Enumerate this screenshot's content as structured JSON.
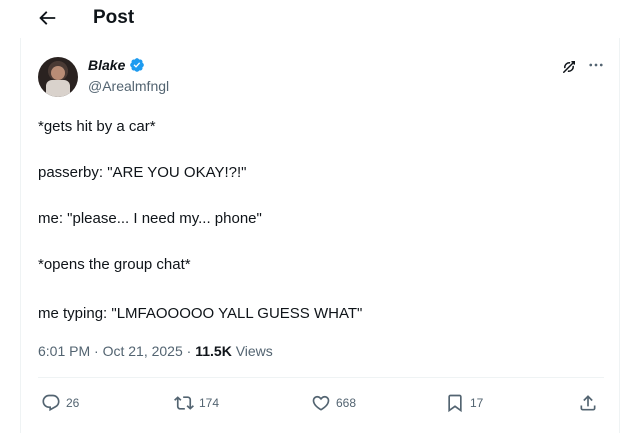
{
  "header": {
    "title": "Post"
  },
  "author": {
    "display_name": "Blake",
    "handle": "@Arealmfngl",
    "verified_color": "#1d9bf0"
  },
  "post": {
    "lines": [
      "*gets hit by a car*",
      "passerby: \"ARE YOU OKAY!?!\"",
      "me: \"please... I need my... phone\"",
      "*opens the group chat*",
      "me typing: \"LMFAOOOOO YALL GUESS WHAT\""
    ],
    "time": "6:01 PM",
    "separator": "·",
    "date": "Oct 21, 2025",
    "views_count": "11.5K",
    "views_label": "Views"
  },
  "actions": {
    "replies": "26",
    "reposts": "174",
    "likes": "668",
    "bookmarks": "17"
  },
  "icons": [
    "back-arrow-icon",
    "verified-badge-icon",
    "grok-icon",
    "more-icon",
    "reply-icon",
    "repost-icon",
    "like-icon",
    "bookmark-icon",
    "share-icon"
  ],
  "colors": {
    "text": "#0f1419",
    "secondary": "#536471",
    "accent": "#1d9bf0",
    "border": "#eff3f4"
  }
}
